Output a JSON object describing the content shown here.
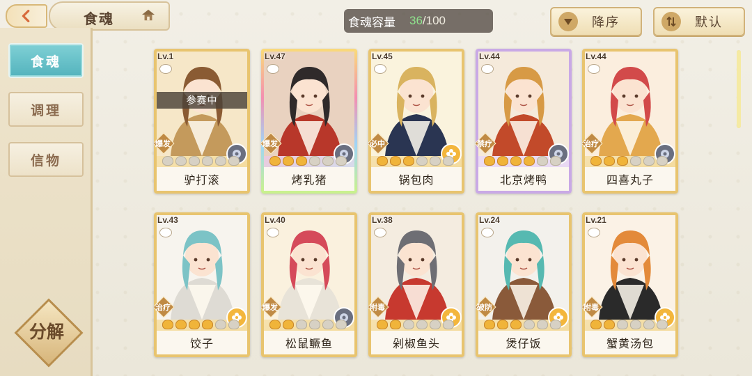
{
  "header": {
    "title": "食魂",
    "capacity_label": "食魂容量",
    "capacity_current": "36",
    "capacity_max": "/100",
    "sort_label": "降序",
    "default_label": "默认"
  },
  "sidebar": {
    "tabs": [
      {
        "label": "食魂",
        "active": true
      },
      {
        "label": "调理",
        "active": false
      },
      {
        "label": "信物",
        "active": false
      }
    ],
    "decompose_label": "分解"
  },
  "cards": [
    {
      "level": "Lv.1",
      "name": "驴打滚",
      "role": "爆发",
      "stars": 0,
      "status": "参赛中",
      "element": "moon",
      "frame": "gold",
      "palette": [
        "#f6e7c8",
        "#c49a5c",
        "#8a5b33"
      ]
    },
    {
      "level": "Lv.47",
      "name": "烤乳猪",
      "role": "爆发",
      "stars": 3,
      "status": "",
      "element": "moon",
      "frame": "rainbow",
      "palette": [
        "#e9d2c0",
        "#b8372a",
        "#2f2a2a"
      ]
    },
    {
      "level": "Lv.45",
      "name": "锅包肉",
      "role": "必中",
      "stars": 3,
      "status": "",
      "element": "flower",
      "frame": "gold",
      "palette": [
        "#faf3dd",
        "#2a3552",
        "#d9b35f"
      ]
    },
    {
      "level": "Lv.44",
      "name": "北京烤鸭",
      "role": "禁疗",
      "stars": 4,
      "status": "",
      "element": "moon",
      "frame": "purple",
      "palette": [
        "#f5eadb",
        "#c24a2a",
        "#d79a45"
      ]
    },
    {
      "level": "Lv.44",
      "name": "四喜丸子",
      "role": "治疗",
      "stars": 3,
      "status": "",
      "element": "moon",
      "frame": "gold",
      "palette": [
        "#fbeede",
        "#e3a84e",
        "#d24a4a"
      ]
    },
    {
      "level": "Lv.43",
      "name": "饺子",
      "role": "治疗",
      "stars": 4,
      "status": "",
      "element": "flower",
      "frame": "gold",
      "palette": [
        "#f7f4ee",
        "#dedbd4",
        "#7cc3c6"
      ]
    },
    {
      "level": "Lv.40",
      "name": "松鼠鳜鱼",
      "role": "爆发",
      "stars": 2,
      "status": "",
      "element": "moon",
      "frame": "gold",
      "palette": [
        "#faf1de",
        "#e8e3d8",
        "#d54a5a"
      ]
    },
    {
      "level": "Lv.38",
      "name": "剁椒鱼头",
      "role": "附毒",
      "stars": 2,
      "status": "",
      "element": "flower",
      "frame": "gold",
      "palette": [
        "#f4ece0",
        "#c7392f",
        "#6e6e74"
      ]
    },
    {
      "level": "Lv.24",
      "name": "煲仔饭",
      "role": "破防",
      "stars": 3,
      "status": "",
      "element": "flower",
      "frame": "gold",
      "palette": [
        "#f3f1ec",
        "#8a5a3a",
        "#56b9b1"
      ]
    },
    {
      "level": "Lv.21",
      "name": "蟹黄汤包",
      "role": "附毒",
      "stars": 2,
      "status": "",
      "element": "flower",
      "frame": "gold",
      "palette": [
        "#fbf2e6",
        "#2a2a2a",
        "#e38a3a"
      ]
    }
  ],
  "colors": {
    "accent_teal": "#53b3bd",
    "gold": "#e8c46f",
    "capacity_green": "#8fe38d"
  }
}
